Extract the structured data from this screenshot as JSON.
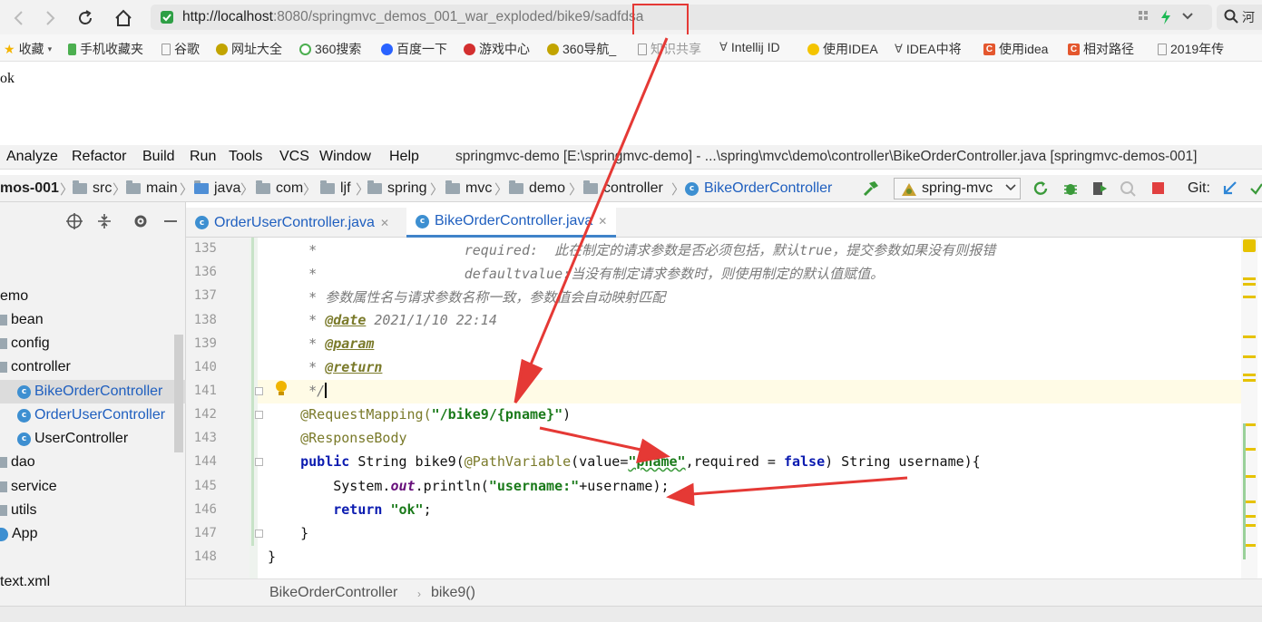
{
  "browser": {
    "url_host": "http://localhost",
    "url_rest": ":8080/springmvc_demos_001_war_exploded/bike9/sadfdsa",
    "search_label": "河"
  },
  "bookmarks": [
    {
      "label": "收藏",
      "icon": "star-icon",
      "color": "#f4b400"
    },
    {
      "label": "手机收藏夹",
      "icon": "phone-icon",
      "color": "#4caf50"
    },
    {
      "label": "谷歌",
      "icon": "page-icon",
      "color": "#888888"
    },
    {
      "label": "网址大全",
      "icon": "earth-icon",
      "color": "#c2a400"
    },
    {
      "label": "360搜索",
      "icon": "search-360-icon",
      "color": "#4caf50"
    },
    {
      "label": "百度一下",
      "icon": "baidu-icon",
      "color": "#2962ff"
    },
    {
      "label": "游戏中心",
      "icon": "game-icon",
      "color": "#d32f2f"
    },
    {
      "label": "360导航_",
      "icon": "earth-icon",
      "color": "#c2a400"
    },
    {
      "label": "知识共享",
      "icon": "page-icon",
      "color": "#888888"
    },
    {
      "label": "Intellij ID",
      "icon": "idea-icon",
      "color": "#555555"
    },
    {
      "label": "使用IDEA",
      "icon": "sun-icon",
      "color": "#f4c400"
    },
    {
      "label": "IDEA中将",
      "icon": "idea-icon",
      "color": "#555555"
    },
    {
      "label": "使用idea",
      "icon": "csdn-icon",
      "color": "#e4572e"
    },
    {
      "label": "相对路径",
      "icon": "csdn-icon",
      "color": "#e4572e"
    },
    {
      "label": "2019年传",
      "icon": "page-icon",
      "color": "#888888"
    }
  ],
  "page_body": "ok",
  "ide": {
    "menu": [
      "Analyze",
      "Refactor",
      "Build",
      "Run",
      "Tools",
      "VCS",
      "Window",
      "Help"
    ],
    "title": "springmvc-demo [E:\\springmvc-demo] - ...\\spring\\mvc\\demo\\controller\\BikeOrderController.java [springmvc-demos-001]",
    "breadcrumbs": [
      "mos-001",
      "src",
      "main",
      "java",
      "com",
      "ljf",
      "spring",
      "mvc",
      "demo",
      "controller",
      "BikeOrderController"
    ],
    "run_config": "spring-mvc",
    "git_label": "Git:",
    "tabs": [
      {
        "label": "OrderUserController.java",
        "active": false
      },
      {
        "label": "BikeOrderController.java",
        "active": true
      }
    ],
    "tree": [
      {
        "label": "emo",
        "kind": "text"
      },
      {
        "label": "bean",
        "kind": "package"
      },
      {
        "label": "config",
        "kind": "package"
      },
      {
        "label": "controller",
        "kind": "package"
      },
      {
        "label": "BikeOrderController",
        "kind": "class",
        "selected": true
      },
      {
        "label": "OrderUserController",
        "kind": "class"
      },
      {
        "label": "UserController",
        "kind": "class"
      },
      {
        "label": "dao",
        "kind": "package"
      },
      {
        "label": "service",
        "kind": "package"
      },
      {
        "label": "utils",
        "kind": "package"
      },
      {
        "label": "App",
        "kind": "class"
      },
      {
        "label": "text.xml",
        "kind": "text"
      }
    ],
    "line_numbers": [
      "135",
      "136",
      "137",
      "138",
      "139",
      "140",
      "141",
      "142",
      "143",
      "144",
      "145",
      "146",
      "147",
      "148"
    ],
    "code": {
      "l135_a": "     *                  required:  ",
      "l135_b": "此在制定的请求参数是否必须包括，默认true，提交参数如果没有则报错",
      "l136_a": "     *                  defaultvalue:",
      "l136_b": "当没有制定请求参数时，则使用制定的默认值赋值。",
      "l137": "     * 参数属性名与请求参数名称一致，参数值会自动映射匹配",
      "l138_a": "     * ",
      "l138_tag": "@date",
      "l138_b": " 2021/1/10 22:14",
      "l139_a": "     * ",
      "l139_tag": "@param",
      "l140_a": "     * ",
      "l140_tag": "@return",
      "l141": "     */",
      "l142_anno": "    @RequestMapping(",
      "l142_str": "\"/bike9/{pname}\"",
      "l142_end": ")",
      "l143": "    @ResponseBody",
      "l144_kw": "    public",
      "l144_a": " String bike9(",
      "l144_anno": "@PathVariable",
      "l144_b": "(value=",
      "l144_str": "\"pname\"",
      "l144_c": ",required = ",
      "l144_kw2": "false",
      "l144_d": ") String username){",
      "l145_a": "        System.",
      "l145_static": "out",
      "l145_b": ".println(",
      "l145_str": "\"username:\"",
      "l145_c": "+username);",
      "l146_kw": "        return",
      "l146_str": " \"ok\"",
      "l146_end": ";",
      "l147": "    }",
      "l148": "}"
    },
    "status_breadcrumb": [
      "BikeOrderController",
      "bike9()"
    ]
  },
  "colors": {
    "annotation_arrow": "#e53935",
    "accent_blue": "#4083c9",
    "string_green": "#1a7a1a",
    "keyword_blue": "#0b1bb0"
  }
}
